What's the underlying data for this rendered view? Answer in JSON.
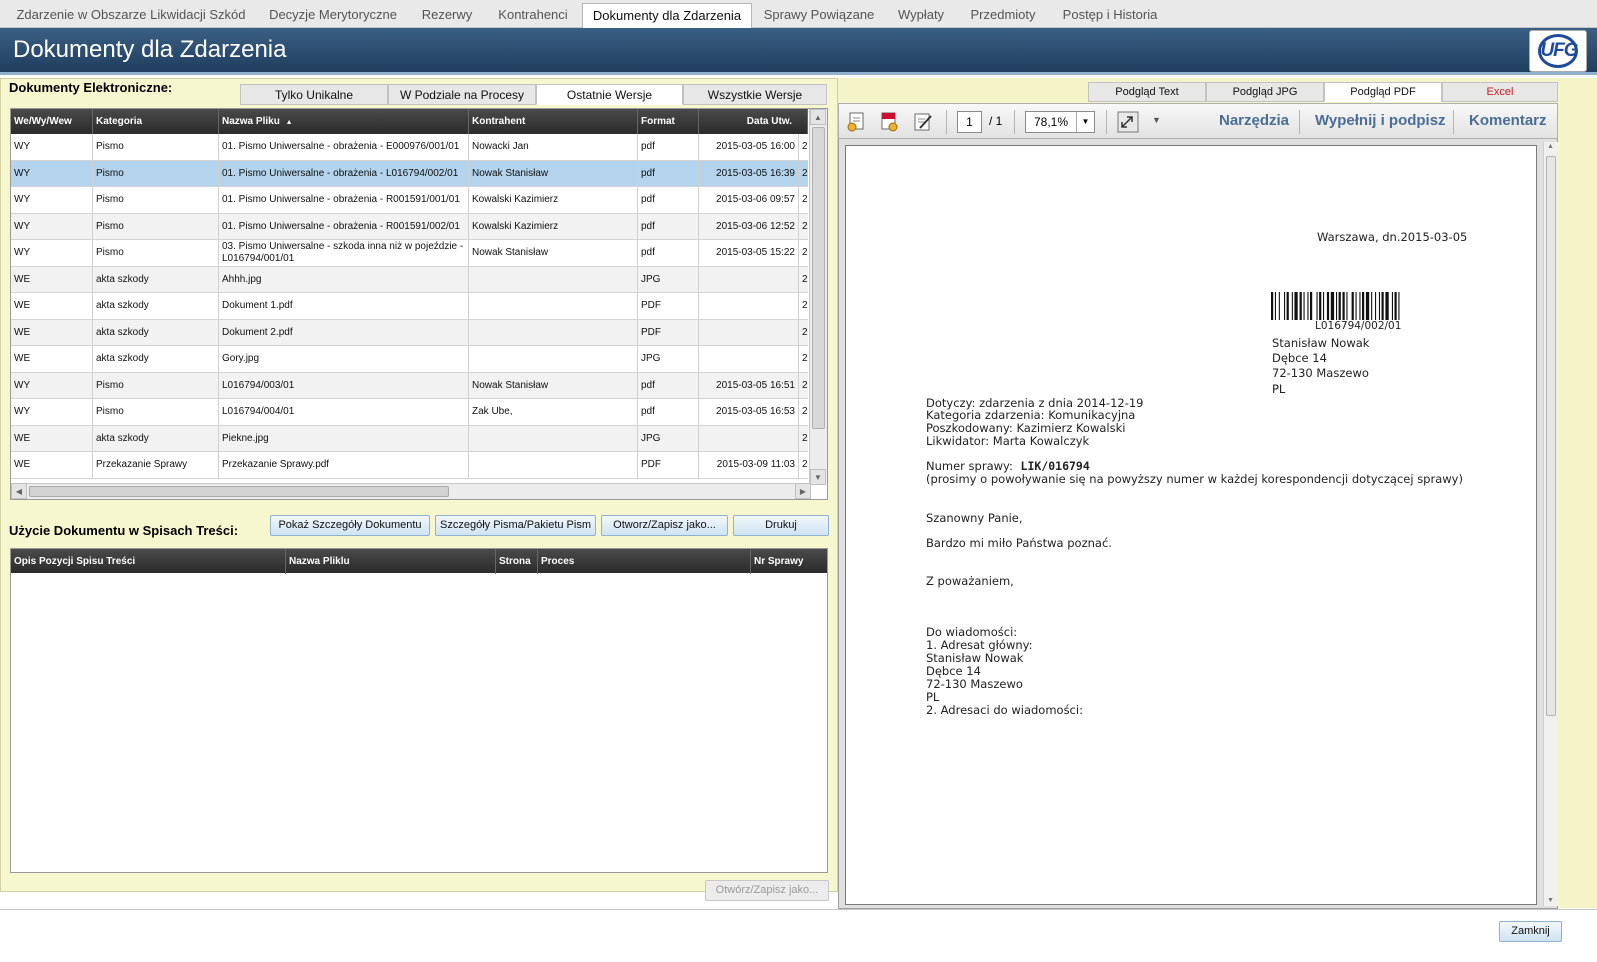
{
  "top_tabs": [
    {
      "label": "Zdarzenie w Obszarze Likwidacji Szkód"
    },
    {
      "label": "Decyzje Merytoryczne"
    },
    {
      "label": "Rezerwy"
    },
    {
      "label": "Kontrahenci"
    },
    {
      "label": "Dokumenty dla Zdarzenia",
      "active": true
    },
    {
      "label": "Sprawy Powiązane"
    },
    {
      "label": "Wypłaty"
    },
    {
      "label": "Przedmioty"
    },
    {
      "label": "Postęp i Historia"
    }
  ],
  "header": {
    "title": "Dokumenty dla Zdarzenia",
    "logo_text": "UFG"
  },
  "left": {
    "section_title": "Dokumenty Elektroniczne:",
    "sub_tabs": [
      "Tylko Unikalne",
      "W Podziale na Procesy",
      "Ostatnie Wersje",
      "Wszystkie Wersje"
    ],
    "active_sub_tab": "Ostatnie Wersje",
    "columns": [
      "We/Wy/Wew",
      "Kategoria",
      "Nazwa Pliku",
      "Kontrahent",
      "Format",
      "Data Utw."
    ],
    "sort_indicator": "▲",
    "rows": [
      {
        "dir": "WY",
        "cat": "Pismo",
        "name": "01. Pismo Uniwersalne - obrażenia - E000976/001/01",
        "contractor": "Nowacki Jan",
        "format": "pdf",
        "date": "2015-03-05 16:00",
        "extra": "2"
      },
      {
        "dir": "WY",
        "cat": "Pismo",
        "name": "01. Pismo Uniwersalne - obrażenia - L016794/002/01",
        "contractor": "Nowak Stanisław",
        "format": "pdf",
        "date": "2015-03-05 16:39",
        "extra": "2",
        "selected": true
      },
      {
        "dir": "WY",
        "cat": "Pismo",
        "name": "01. Pismo Uniwersalne - obrażenia - R001591/001/01",
        "contractor": "Kowalski Kazimierz",
        "format": "pdf",
        "date": "2015-03-06 09:57",
        "extra": "2"
      },
      {
        "dir": "WY",
        "cat": "Pismo",
        "name": "01. Pismo Uniwersalne - obrażenia - R001591/002/01",
        "contractor": "Kowalski Kazimierz",
        "format": "pdf",
        "date": "2015-03-06 12:52",
        "extra": "2"
      },
      {
        "dir": "WY",
        "cat": "Pismo",
        "name": "03. Pismo Uniwersalne - szkoda inna niż w pojeździe - L016794/001/01",
        "contractor": "Nowak Stanisław",
        "format": "pdf",
        "date": "2015-03-05 15:22",
        "extra": "2"
      },
      {
        "dir": "WE",
        "cat": "akta szkody",
        "name": "Ahhh.jpg",
        "contractor": "",
        "format": "JPG",
        "date": "",
        "extra": "2"
      },
      {
        "dir": "WE",
        "cat": "akta szkody",
        "name": "Dokument 1.pdf",
        "contractor": "",
        "format": "PDF",
        "date": "",
        "extra": "2"
      },
      {
        "dir": "WE",
        "cat": "akta szkody",
        "name": "Dokument 2.pdf",
        "contractor": "",
        "format": "PDF",
        "date": "",
        "extra": "2"
      },
      {
        "dir": "WE",
        "cat": "akta szkody",
        "name": "Gory.jpg",
        "contractor": "",
        "format": "JPG",
        "date": "",
        "extra": "2"
      },
      {
        "dir": "WY",
        "cat": "Pismo",
        "name": "L016794/003/01",
        "contractor": "Nowak Stanisław",
        "format": "pdf",
        "date": "2015-03-05 16:51",
        "extra": "2"
      },
      {
        "dir": "WY",
        "cat": "Pismo",
        "name": "L016794/004/01",
        "contractor": "Zak Ube,",
        "format": "pdf",
        "date": "2015-03-05 16:53",
        "extra": "2"
      },
      {
        "dir": "WE",
        "cat": "akta szkody",
        "name": "Piekne.jpg",
        "contractor": "",
        "format": "JPG",
        "date": "",
        "extra": "2"
      },
      {
        "dir": "WE",
        "cat": "Przekazanie Sprawy",
        "name": "Przekazanie Sprawy.pdf",
        "contractor": "",
        "format": "PDF",
        "date": "2015-03-09 11:03",
        "extra": "2"
      }
    ],
    "usage_title": "Użycie Dokumentu w Spisach Treści:",
    "buttons": [
      "Pokaż Szczegóły Dokumentu",
      "Szczegóły Pisma/Pakietu Pism",
      "Otworz/Zapisz jako...",
      "Drukuj"
    ],
    "usage_columns": [
      "Opis Pozycji Spisu Treści",
      "Nazwa Pliklu",
      "Strona",
      "Proces",
      "Nr Sprawy"
    ],
    "bottom_button": "Otwórz/Zapisz jako..."
  },
  "right": {
    "preview_tabs": [
      "Podgląd Text",
      "Podgląd JPG",
      "Podgląd PDF",
      "Excel"
    ],
    "active_preview_tab": "Podgląd PDF",
    "excel_color": "#d21b1b",
    "toolbar": {
      "page_current": "1",
      "page_total": "/ 1",
      "zoom": "78,1%",
      "tools": "Narzędzia",
      "fill_sign": "Wypełnij i podpisz",
      "comment": "Komentarz"
    },
    "pdf": {
      "place_date": "Warszawa, dn.2015-03-05",
      "barcode_text": "L016794/002/01",
      "addressee": [
        "Stanisław Nowak",
        "Dębce 14",
        "72-130 Maszewo",
        "PL"
      ],
      "subject_lines": [
        "Dotyczy: zdarzenia z dnia  2014-12-19",
        "Kategoria zdarzenia:  Komunikacyjna",
        "Poszkodowany:  Kazimierz Kowalski",
        "Likwidator:  Marta Kowalczyk"
      ],
      "case_number_label": "Numer sprawy:",
      "case_number": "LIK/016794",
      "case_note": "(prosimy o powoływanie się na powyższy numer w każdej korespondencji dotyczącej sprawy)",
      "greeting": "Szanowny Panie,",
      "body": "Bardzo mi miło Państwa poznać.",
      "closing": "Z poważaniem,",
      "cc_lines": [
        "Do wiadomości:",
        "1. Adresat główny:",
        "Stanisław Nowak",
        "Dębce 14",
        "72-130 Maszewo",
        "PL",
        "2. Adresaci do wiadomości:"
      ]
    }
  },
  "footer": {
    "close_label": "Zamknij"
  },
  "colors": {
    "header_bg": "#2b4d70",
    "panel_bg": "#f7f7cf",
    "selected_row": "#b3d4ec",
    "toolbar_text": "#4b6e96"
  }
}
